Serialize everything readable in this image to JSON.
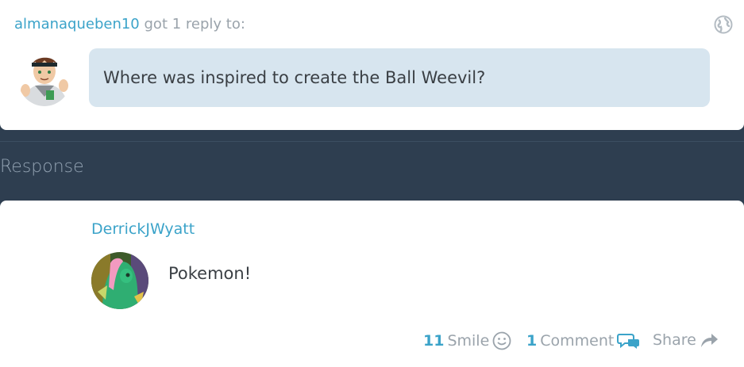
{
  "question": {
    "asker": "almanaqueben10",
    "notice": "got 1 reply to:",
    "text": "Where was inspired to create the Ball Weevil?",
    "visibility_icon": "globe-icon"
  },
  "response_section": {
    "label": "Response"
  },
  "response": {
    "author": "DerrickJWyatt",
    "text": "Pokemon!",
    "actions": {
      "smile_count": "11",
      "smile_label": "Smile",
      "smile_icon": "smiley-icon",
      "comment_count": "1",
      "comment_label": "Comment",
      "comment_icon": "speech-bubbles-icon",
      "share_label": "Share",
      "share_icon": "share-arrow-icon"
    }
  },
  "colors": {
    "page_background": "#2e3e50",
    "card_background": "#ffffff",
    "bubble_background": "#d7e5ef",
    "link_blue": "#3ba3c9",
    "muted_gray": "#9aa3ab"
  }
}
